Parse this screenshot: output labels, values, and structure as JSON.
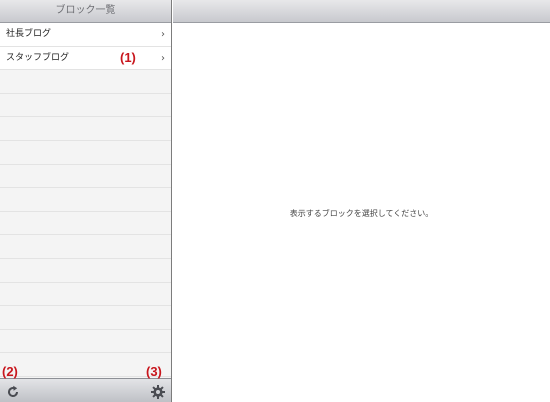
{
  "sidebar": {
    "title": "ブロック一覧",
    "items": [
      {
        "label": "社長ブログ"
      },
      {
        "label": "スタッフブログ"
      }
    ],
    "empty_rows": 13
  },
  "main": {
    "message": "表示するブロックを選択してください。"
  },
  "callouts": {
    "item": "(1)",
    "refresh": "(2)",
    "settings": "(3)"
  },
  "icons": {
    "chevron": "chevron-right-icon",
    "refresh": "refresh-icon",
    "settings": "gear-icon"
  }
}
